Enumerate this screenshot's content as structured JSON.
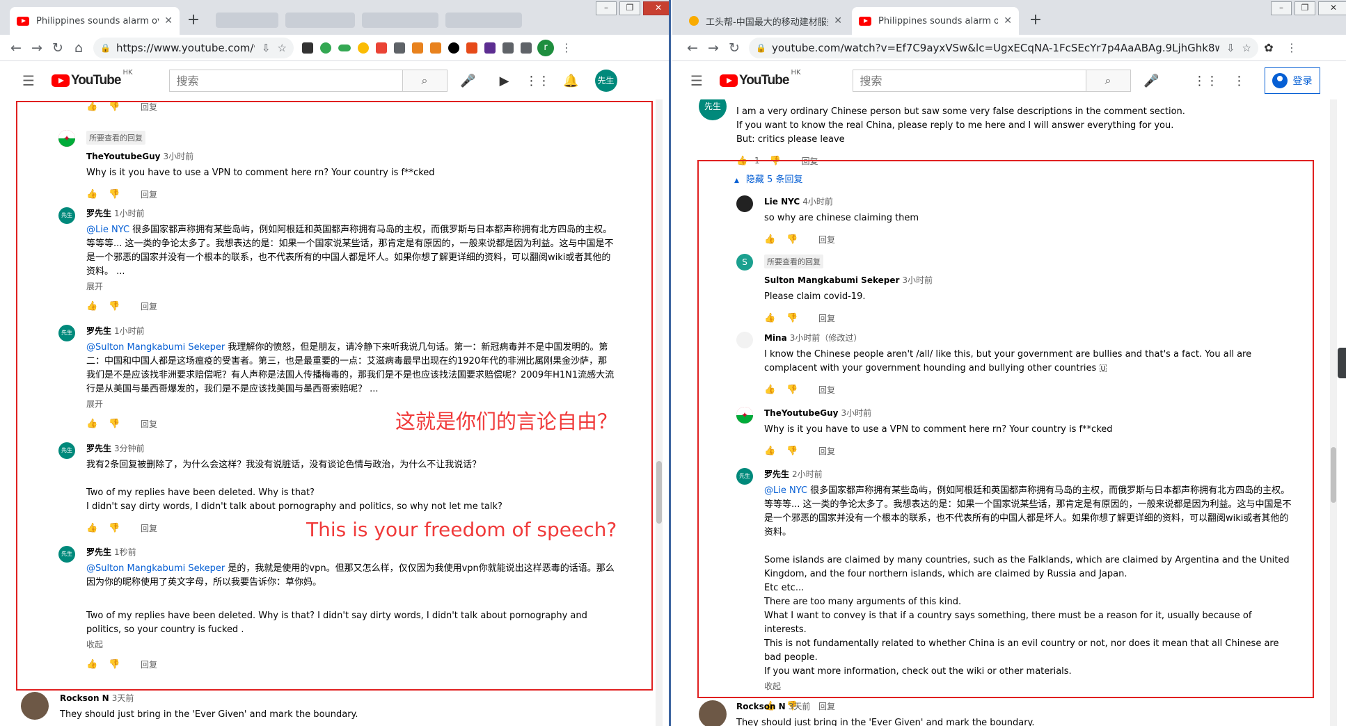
{
  "left": {
    "tabs": [
      {
        "title": "Philippines sounds alarm over",
        "close": "✕"
      }
    ],
    "new_tab": "+",
    "url": "https://www.youtube.com/w...",
    "search_placeholder": "搜索",
    "header_avatar": "先生",
    "yt_logo": "YouTube",
    "yt_region": "HK",
    "profile_initial": "r",
    "comments": [
      {
        "author": "",
        "time": "",
        "text": "",
        "reply": "回复",
        "actions_only": true
      },
      {
        "pinned": "所要查看的回复",
        "author": "TheYoutubeGuy",
        "time": "3小时前",
        "text": "Why is it you have to use a VPN to comment here rn? Your country is f**cked",
        "reply": "回复",
        "avatar": "flag"
      },
      {
        "author": "罗先生",
        "time": "1小时前",
        "mention": "@Lie NYC",
        "text": " 很多国家都声称拥有某些岛屿，例如阿根廷和英国都声称拥有马岛的主权，而俄罗斯与日本都声称拥有北方四岛的主权。等等等...  这一类的争论太多了。我想表达的是：如果一个国家说某些话，那肯定是有原因的，一般来说都是因为利益。这与中国是不是一个邪恶的国家并没有一个根本的联系，也不代表所有的中国人都是坏人。如果你想了解更详细的资料，可以翻阅wiki或者其他的资料。  ...",
        "more": "展开",
        "reply": "回复",
        "avatar": "先生"
      },
      {
        "author": "罗先生",
        "time": "1小时前",
        "mention": "@Sulton Mangkabumi Sekeper",
        "text": " 我理解你的愤怒，但是朋友，请冷静下来听我说几句话。第一：新冠病毒并不是中国发明的。第二：中国和中国人都是这场瘟疫的受害者。第三，也是最重要的一点：艾滋病毒最早出现在约1920年代的非洲比属刚果金沙萨，那我们是不是应该找非洲要求赔偿呢？有人声称是法国人传播梅毒的，那我们是不是也应该找法国要求赔偿呢？2009年H1N1流感大流行是从美国与墨西哥爆发的，我们是不是应该找美国与墨西哥索赔呢？  ...",
        "more": "展开",
        "reply": "回复",
        "avatar": "先生"
      },
      {
        "author": "罗先生",
        "time": "3分钟前",
        "text": "我有2条回复被删除了，为什么会这样？我没有说脏话，没有谈论色情与政治，为什么不让我说话？",
        "text2": "Two of my replies have been deleted. Why is that?",
        "text3": "I didn't say dirty words, I didn't talk about pornography and politics, so why not let me talk?",
        "reply": "回复",
        "avatar": "先生"
      },
      {
        "author": "罗先生",
        "time": "1秒前",
        "mention": "@Sulton Mangkabumi Sekeper",
        "text": " 是的，我就是使用的vpn。但那又怎么样，仅仅因为我使用vpn你就能说出这样恶毒的话语。那么因为你的昵称使用了英文字母，所以我要告诉你：草你妈。",
        "text2": "Two of my replies have been deleted. Why is that? I didn't say dirty words, I didn't talk about pornography and politics, so your country is fucked .",
        "more": "收起",
        "reply": "回复",
        "avatar": "先生"
      },
      {
        "author": "Rockson N",
        "time": "3天前",
        "text": "They should just bring in the 'Ever Given' and mark the boundary."
      }
    ],
    "overlay_cn": "这就是你们的言论自由？",
    "overlay_en": "This is your freedom of speech?"
  },
  "right": {
    "tabs": [
      {
        "title": "工头帮-中国最大的移动建材服务",
        "close": "✕"
      },
      {
        "title": "Philippines sounds alarm over",
        "close": "✕"
      }
    ],
    "new_tab": "+",
    "url": "youtube.com/watch?v=Ef7C9ayxVSw&lc=UgxECqNA-1FcSEcYr7p4AaABAg.9LjhGhk8wkY9L...",
    "search_placeholder": "搜索",
    "yt_logo": "YouTube",
    "yt_region": "HK",
    "signin": "登录",
    "header_avatar": "先生",
    "top_comment": {
      "line1": "I am a very ordinary Chinese person but saw some very false descriptions in the comment section.",
      "line2": "If you want to know the real China, please reply to me here and I will answer everything for you.",
      "line3": "But: critics please leave",
      "likes": "1",
      "reply": "回复"
    },
    "hide_replies": "隐藏 5 条回复",
    "comments": [
      {
        "author": "Lie NYC",
        "time": "4小时前",
        "text": "so why are chinese claiming them",
        "reply": "回复",
        "avatar": "dark"
      },
      {
        "pinned": "所要查看的回复",
        "author": "Sulton Mangkabumi Sekeper",
        "time": "3小时前",
        "text": "Please claim covid-19.",
        "reply": "回复",
        "avatar": "S"
      },
      {
        "author": "Mina",
        "time": "3小时前（修改过）",
        "text": "I know the Chinese people aren't /all/ like this, but your government are bullies and that's a fact. You all are complacent with your government hounding and bullying other countries 🇺",
        "reply": "回复",
        "avatar": "blank"
      },
      {
        "author": "TheYoutubeGuy",
        "time": "3小时前",
        "text": "Why is it you have to use a VPN to comment here rn? Your country is f**cked",
        "reply": "回复",
        "avatar": "flag"
      },
      {
        "author": "罗先生",
        "time": "2小时前",
        "mention": "@Lie NYC",
        "text": " 很多国家都声称拥有某些岛屿，例如阿根廷和英国都声称拥有马岛的主权，而俄罗斯与日本都声称拥有北方四岛的主权。等等等...  这一类的争论太多了。我想表达的是：如果一个国家说某些话，那肯定是有原因的，一般来说都是因为利益。这与中国是不是一个邪恶的国家并没有一个根本的联系，也不代表所有的中国人都是坏人。如果你想了解更详细的资料，可以翻阅wiki或者其他的资料。",
        "en1": "Some islands are claimed by many countries, such as the Falklands, which are claimed by Argentina and the United Kingdom, and the four northern islands, which are claimed by Russia and Japan.",
        "en2": "Etc etc...",
        "en3": "There are too many arguments of this kind.",
        "en4": "What I want to convey is that if a country says something, there must be a reason for it, usually because of interests.",
        "en5": "This is not fundamentally related to whether China is an evil country or not, nor does it mean that all Chinese are bad people.",
        "en6": "If you want more information, check out the wiki or other materials.",
        "more": "收起",
        "reply": "回复",
        "avatar": "先生"
      },
      {
        "author": "Rockson N",
        "time": "3天前",
        "text": "They should just bring in the 'Ever Given' and mark the boundary."
      }
    ]
  }
}
